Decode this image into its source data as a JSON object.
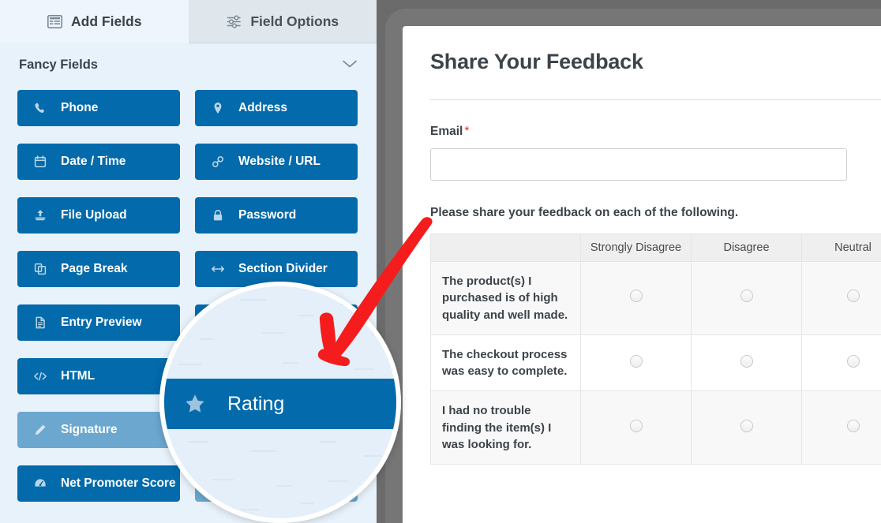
{
  "sidebar": {
    "tabs": [
      {
        "label": "Add Fields",
        "icon": "form-list-icon",
        "active": true
      },
      {
        "label": "Field Options",
        "icon": "sliders-icon",
        "active": false
      }
    ],
    "section": {
      "title": "Fancy Fields",
      "chevron": "chevron-down-icon"
    },
    "fields": [
      {
        "label": "Phone",
        "icon": "phone-icon"
      },
      {
        "label": "Address",
        "icon": "map-pin-icon"
      },
      {
        "label": "Date / Time",
        "icon": "calendar-icon"
      },
      {
        "label": "Website / URL",
        "icon": "link-icon"
      },
      {
        "label": "File Upload",
        "icon": "upload-icon"
      },
      {
        "label": "Password",
        "icon": "lock-icon"
      },
      {
        "label": "Page Break",
        "icon": "pages-icon"
      },
      {
        "label": "Section Divider",
        "icon": "arrows-horizontal-icon"
      },
      {
        "label": "Entry Preview",
        "icon": "document-icon"
      },
      {
        "label": "Rating",
        "icon": "star-icon"
      },
      {
        "label": "HTML",
        "icon": "code-icon"
      },
      {
        "label": "",
        "icon": ""
      },
      {
        "label": "Signature",
        "icon": "pencil-icon"
      },
      {
        "label": "",
        "icon": ""
      },
      {
        "label": "Net Promoter Score",
        "icon": "gauge-icon"
      },
      {
        "label": "",
        "icon": ""
      }
    ]
  },
  "magnifier": {
    "field_label": "Rating",
    "field_icon": "star-icon"
  },
  "annotation": {
    "arrow_color": "#f41c1c",
    "arrow_name": "red-arrow-pointer"
  },
  "form": {
    "title": "Share Your Feedback",
    "email": {
      "label": "Email",
      "required_marker": "*",
      "value": "",
      "placeholder": ""
    },
    "likert": {
      "description": "Please share your feedback on each of the following.",
      "columns": [
        "",
        "Strongly Disagree",
        "Disagree",
        "Neutral"
      ],
      "rows": [
        {
          "label": "The product(s) I purchased is of high quality and well made."
        },
        {
          "label": "The checkout process was easy to complete."
        },
        {
          "label": "I had no trouble finding the item(s) I was looking for."
        }
      ]
    }
  },
  "colors": {
    "field_button": "#036aab",
    "field_button_muted": "#6ba7cf",
    "sidebar_bg": "#e8f2fb",
    "required": "#d63638",
    "backdrop": "#6b6b6b"
  }
}
